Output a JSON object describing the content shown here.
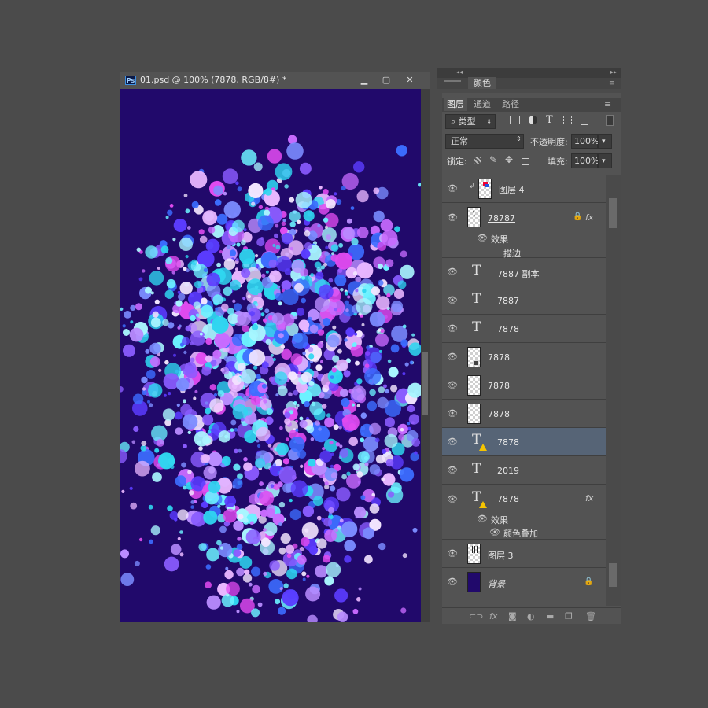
{
  "document": {
    "title": "01.psd @ 100% (7878, RGB/8#) *",
    "app_badge": "Ps",
    "canvas_color": "#21096b",
    "dot_colors": [
      "#8a5cff",
      "#5b3cff",
      "#c86bff",
      "#e14bf0",
      "#6cf2ff",
      "#2fd6f0",
      "#f3e6ff",
      "#b98cff",
      "#7b8cff",
      "#e8b6ff",
      "#3c6dff",
      "#a9f6ff"
    ]
  },
  "window_buttons": {
    "minimize": "▁",
    "maximize": "▢",
    "close": "✕"
  },
  "top_strip": {
    "collapse_left": "◂◂",
    "collapse_right": "▸▸"
  },
  "color_panel": {
    "tab_label": "颜色"
  },
  "layers_panel": {
    "tabs": [
      {
        "label": "图层",
        "active": true
      },
      {
        "label": "通道",
        "active": false
      },
      {
        "label": "路径",
        "active": false
      }
    ],
    "filter_kind": "类型",
    "blend_mode": "正常",
    "opacity_label": "不透明度:",
    "opacity_value": "100%",
    "lock_label": "锁定:",
    "fill_label": "填充:",
    "fill_value": "100%",
    "layers": [
      {
        "name": "图层 4",
        "kind": "image",
        "clipped": true
      },
      {
        "name": "78787",
        "kind": "smart",
        "locked": true,
        "fx": "fx",
        "effects_label": "效果",
        "effects": [
          "描边"
        ]
      },
      {
        "name": "7887 副本",
        "kind": "text"
      },
      {
        "name": "7887",
        "kind": "text"
      },
      {
        "name": "7878",
        "kind": "text"
      },
      {
        "name": "7878",
        "kind": "smart-object"
      },
      {
        "name": "7878",
        "kind": "empty"
      },
      {
        "name": "7878",
        "kind": "empty"
      },
      {
        "name": "7878",
        "kind": "text-warning",
        "selected": true
      },
      {
        "name": "2019",
        "kind": "text"
      },
      {
        "name": "7878",
        "kind": "text-warning",
        "fx": "fx",
        "effects_label": "效果",
        "effects": [
          "颜色叠加"
        ]
      },
      {
        "name": "图层 3",
        "kind": "image"
      },
      {
        "name": "背景",
        "kind": "background",
        "locked": true
      }
    ],
    "bottom_icons": [
      "link-icon",
      "fx-icon",
      "mask-icon",
      "adjustment-icon",
      "group-icon",
      "new-layer-icon",
      "trash-icon"
    ],
    "fx_text": "fx"
  }
}
